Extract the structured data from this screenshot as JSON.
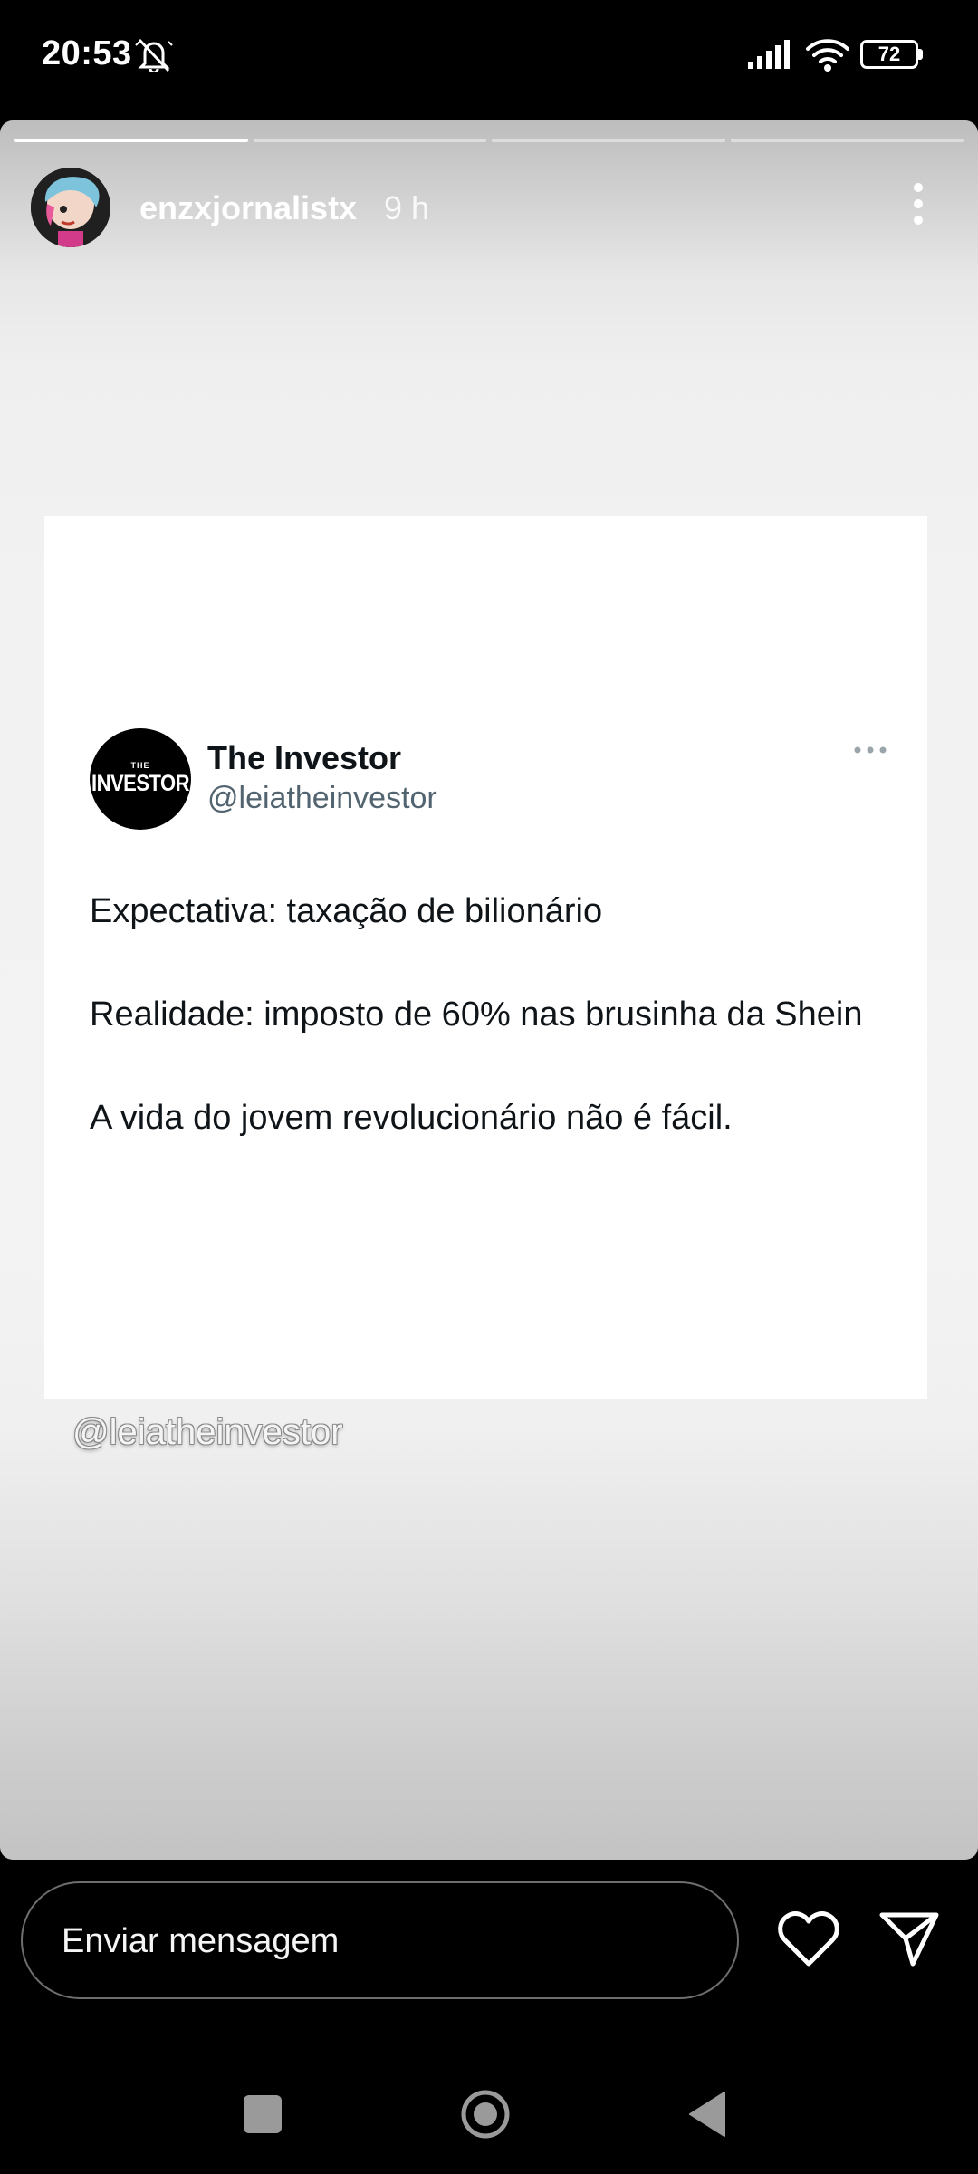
{
  "status_bar": {
    "time": "20:53",
    "battery_level": "72",
    "icons": [
      "dnd-icon",
      "signal-icon",
      "wifi-icon",
      "battery-icon"
    ]
  },
  "story": {
    "username": "enzxjornalistx",
    "time_ago": "9 h",
    "progress": {
      "total_segments": 4,
      "current_segment": 1,
      "current_fill": 0.5
    },
    "colors": {
      "background": "#f2f2f2",
      "text_on_story": "#ffffff"
    }
  },
  "tweet": {
    "display_name": "The Investor",
    "handle": "@leiatheinvestor",
    "logo_small": "THE",
    "logo_main": "INVESTOR",
    "lines": [
      "Expectativa: taxação de bilionário",
      "",
      "Realidade: imposto de 60% nas brusinha da Shein",
      "",
      "A vida do jovem revolucionário não é fácil."
    ],
    "colors": {
      "name": "#0f1419",
      "handle": "#536471",
      "card": "#ffffff"
    }
  },
  "watermark": "@leiatheinvestor",
  "reply_bar": {
    "placeholder": "Enviar mensagem",
    "icons": [
      "heart-icon",
      "send-icon"
    ]
  },
  "nav_bar": {
    "icons": [
      "recents-icon",
      "home-icon",
      "back-icon"
    ]
  }
}
